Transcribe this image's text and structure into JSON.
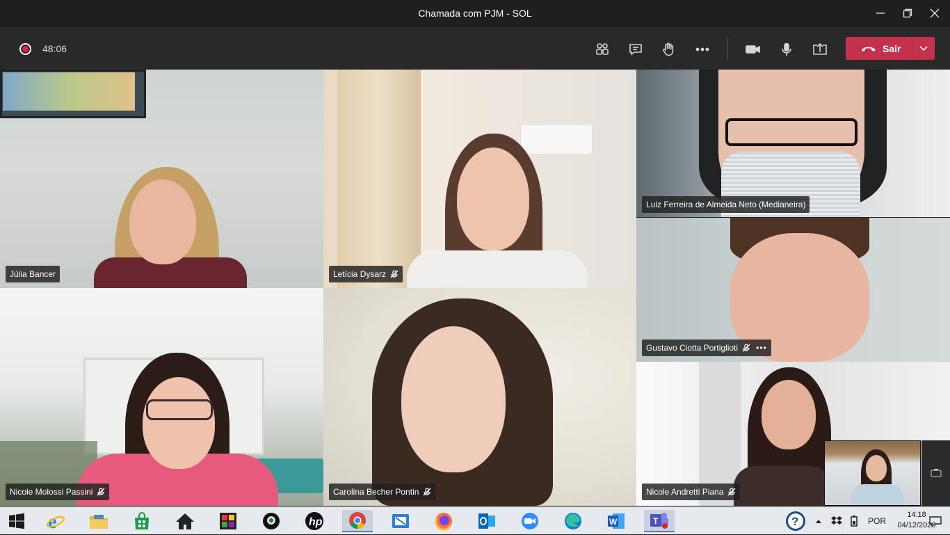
{
  "window": {
    "title": "Chamada com PJM - SOL"
  },
  "toolbar": {
    "timer": "48:06",
    "leave_label": "Sair"
  },
  "participants": [
    {
      "name": "Júlia Bancer",
      "muted": false
    },
    {
      "name": "Letícia Dysarz",
      "muted": true
    },
    {
      "name": "Luiz Ferreira de Almeida Neto (Medianeira)",
      "muted": false
    },
    {
      "name": "Gustavo Ciotta Portiglioti",
      "muted": true,
      "more": "•••"
    },
    {
      "name": "Nicole Molossi Passini",
      "muted": true
    },
    {
      "name": "Carolina Becher Pontin",
      "muted": true
    },
    {
      "name": "Nicole Andretti Piana",
      "muted": true
    }
  ],
  "taskbar": {
    "apps": [
      "start-icon",
      "ie-icon",
      "file-explorer-icon",
      "store-icon",
      "home-icon",
      "photos-icon",
      "webcam-app-icon",
      "hp-icon",
      "chrome-icon",
      "snipping-icon",
      "firefox-icon",
      "outlook-icon",
      "zoom-icon",
      "edge-icon",
      "word-icon",
      "teams-icon"
    ],
    "language": "POR",
    "time": "14:18",
    "date": "04/12/2020"
  },
  "colors": {
    "leave": "#c4314b",
    "record": "#e0253c",
    "toolbar": "#292929"
  }
}
